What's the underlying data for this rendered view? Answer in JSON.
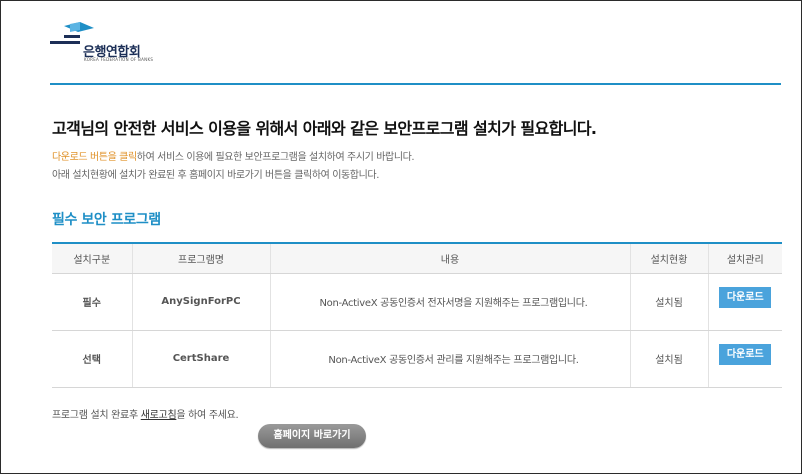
{
  "logo": {
    "name": "은행연합회",
    "subtitle": "KOREA FEDERATION OF BANKS"
  },
  "headline": "고객님의 안전한 서비스 이용을 위해서 아래와 같은 보안프로그램 설치가 필요합니다.",
  "description": {
    "highlight": "다운로드 버튼을 클릭",
    "line1_rest": "하여 서비스 이용에 필요한 보안프로그램을 설치하여 주시기 바랍니다.",
    "line2": "아래 설치현황에 설치가 완료된 후 홈페이지 바로가기 버튼을 클릭하여 이동합니다."
  },
  "section_title": "필수 보안 프로그램",
  "table": {
    "headers": [
      "설치구분",
      "프로그램명",
      "내용",
      "설치현황",
      "설치관리"
    ],
    "rows": [
      {
        "type": "필수",
        "name": "AnySignForPC",
        "description": "Non-ActiveX 공동인증서 전자서명을 지원해주는 프로그램입니다.",
        "status": "설치됨",
        "action": "다운로드"
      },
      {
        "type": "선택",
        "name": "CertShare",
        "description": "Non-ActiveX 공동인증서 관리를 지원해주는 프로그램입니다.",
        "status": "설치됨",
        "action": "다운로드"
      }
    ]
  },
  "footer": {
    "before": "프로그램 설치 완료후 ",
    "link": "새로고침",
    "after": "을 하여 주세요."
  },
  "home_button": "홈페이지 바로가기",
  "colors": {
    "accent": "#1f8fc6",
    "highlight": "#e0922a",
    "required": "#c0121d",
    "button": "#4aa3dc"
  }
}
